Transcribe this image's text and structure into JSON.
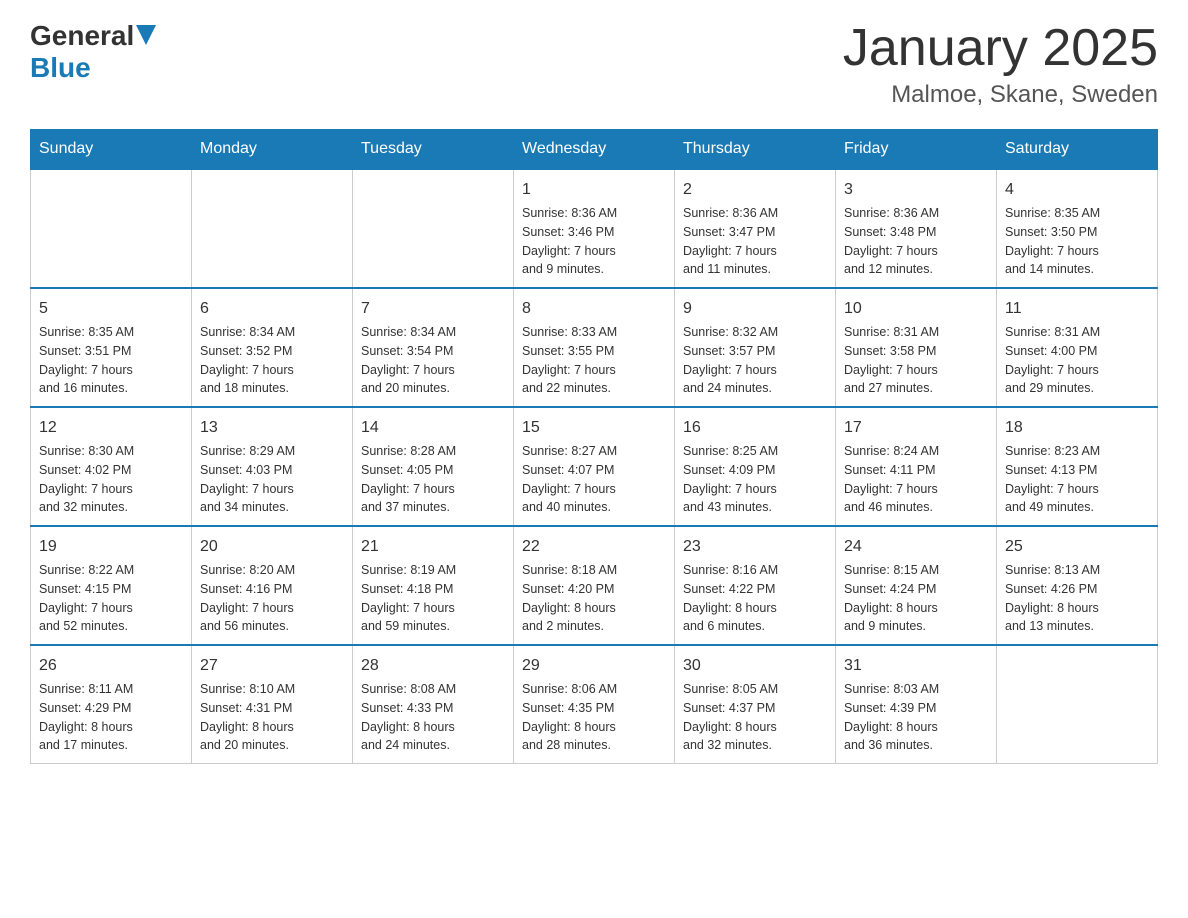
{
  "header": {
    "logo_general": "General",
    "logo_blue": "Blue",
    "title": "January 2025",
    "subtitle": "Malmoe, Skane, Sweden"
  },
  "days_of_week": [
    "Sunday",
    "Monday",
    "Tuesday",
    "Wednesday",
    "Thursday",
    "Friday",
    "Saturday"
  ],
  "weeks": [
    [
      {
        "day": "",
        "info": ""
      },
      {
        "day": "",
        "info": ""
      },
      {
        "day": "",
        "info": ""
      },
      {
        "day": "1",
        "info": "Sunrise: 8:36 AM\nSunset: 3:46 PM\nDaylight: 7 hours\nand 9 minutes."
      },
      {
        "day": "2",
        "info": "Sunrise: 8:36 AM\nSunset: 3:47 PM\nDaylight: 7 hours\nand 11 minutes."
      },
      {
        "day": "3",
        "info": "Sunrise: 8:36 AM\nSunset: 3:48 PM\nDaylight: 7 hours\nand 12 minutes."
      },
      {
        "day": "4",
        "info": "Sunrise: 8:35 AM\nSunset: 3:50 PM\nDaylight: 7 hours\nand 14 minutes."
      }
    ],
    [
      {
        "day": "5",
        "info": "Sunrise: 8:35 AM\nSunset: 3:51 PM\nDaylight: 7 hours\nand 16 minutes."
      },
      {
        "day": "6",
        "info": "Sunrise: 8:34 AM\nSunset: 3:52 PM\nDaylight: 7 hours\nand 18 minutes."
      },
      {
        "day": "7",
        "info": "Sunrise: 8:34 AM\nSunset: 3:54 PM\nDaylight: 7 hours\nand 20 minutes."
      },
      {
        "day": "8",
        "info": "Sunrise: 8:33 AM\nSunset: 3:55 PM\nDaylight: 7 hours\nand 22 minutes."
      },
      {
        "day": "9",
        "info": "Sunrise: 8:32 AM\nSunset: 3:57 PM\nDaylight: 7 hours\nand 24 minutes."
      },
      {
        "day": "10",
        "info": "Sunrise: 8:31 AM\nSunset: 3:58 PM\nDaylight: 7 hours\nand 27 minutes."
      },
      {
        "day": "11",
        "info": "Sunrise: 8:31 AM\nSunset: 4:00 PM\nDaylight: 7 hours\nand 29 minutes."
      }
    ],
    [
      {
        "day": "12",
        "info": "Sunrise: 8:30 AM\nSunset: 4:02 PM\nDaylight: 7 hours\nand 32 minutes."
      },
      {
        "day": "13",
        "info": "Sunrise: 8:29 AM\nSunset: 4:03 PM\nDaylight: 7 hours\nand 34 minutes."
      },
      {
        "day": "14",
        "info": "Sunrise: 8:28 AM\nSunset: 4:05 PM\nDaylight: 7 hours\nand 37 minutes."
      },
      {
        "day": "15",
        "info": "Sunrise: 8:27 AM\nSunset: 4:07 PM\nDaylight: 7 hours\nand 40 minutes."
      },
      {
        "day": "16",
        "info": "Sunrise: 8:25 AM\nSunset: 4:09 PM\nDaylight: 7 hours\nand 43 minutes."
      },
      {
        "day": "17",
        "info": "Sunrise: 8:24 AM\nSunset: 4:11 PM\nDaylight: 7 hours\nand 46 minutes."
      },
      {
        "day": "18",
        "info": "Sunrise: 8:23 AM\nSunset: 4:13 PM\nDaylight: 7 hours\nand 49 minutes."
      }
    ],
    [
      {
        "day": "19",
        "info": "Sunrise: 8:22 AM\nSunset: 4:15 PM\nDaylight: 7 hours\nand 52 minutes."
      },
      {
        "day": "20",
        "info": "Sunrise: 8:20 AM\nSunset: 4:16 PM\nDaylight: 7 hours\nand 56 minutes."
      },
      {
        "day": "21",
        "info": "Sunrise: 8:19 AM\nSunset: 4:18 PM\nDaylight: 7 hours\nand 59 minutes."
      },
      {
        "day": "22",
        "info": "Sunrise: 8:18 AM\nSunset: 4:20 PM\nDaylight: 8 hours\nand 2 minutes."
      },
      {
        "day": "23",
        "info": "Sunrise: 8:16 AM\nSunset: 4:22 PM\nDaylight: 8 hours\nand 6 minutes."
      },
      {
        "day": "24",
        "info": "Sunrise: 8:15 AM\nSunset: 4:24 PM\nDaylight: 8 hours\nand 9 minutes."
      },
      {
        "day": "25",
        "info": "Sunrise: 8:13 AM\nSunset: 4:26 PM\nDaylight: 8 hours\nand 13 minutes."
      }
    ],
    [
      {
        "day": "26",
        "info": "Sunrise: 8:11 AM\nSunset: 4:29 PM\nDaylight: 8 hours\nand 17 minutes."
      },
      {
        "day": "27",
        "info": "Sunrise: 8:10 AM\nSunset: 4:31 PM\nDaylight: 8 hours\nand 20 minutes."
      },
      {
        "day": "28",
        "info": "Sunrise: 8:08 AM\nSunset: 4:33 PM\nDaylight: 8 hours\nand 24 minutes."
      },
      {
        "day": "29",
        "info": "Sunrise: 8:06 AM\nSunset: 4:35 PM\nDaylight: 8 hours\nand 28 minutes."
      },
      {
        "day": "30",
        "info": "Sunrise: 8:05 AM\nSunset: 4:37 PM\nDaylight: 8 hours\nand 32 minutes."
      },
      {
        "day": "31",
        "info": "Sunrise: 8:03 AM\nSunset: 4:39 PM\nDaylight: 8 hours\nand 36 minutes."
      },
      {
        "day": "",
        "info": ""
      }
    ]
  ]
}
